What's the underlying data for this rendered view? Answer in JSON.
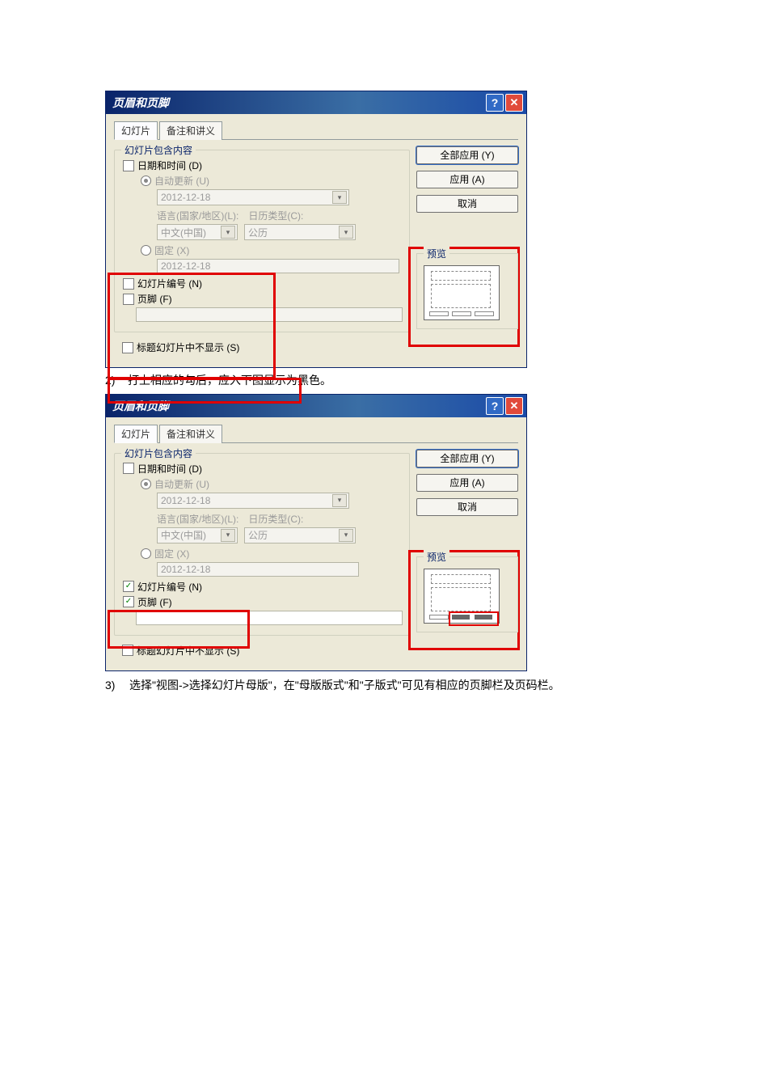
{
  "dialog": {
    "title": "页眉和页脚",
    "help": "?",
    "close": "✕",
    "tabs": {
      "slide": "幻灯片",
      "notes": "备注和讲义"
    },
    "group_title": "幻灯片包含内容",
    "date_time": "日期和时间 (D)",
    "auto_update": "自动更新 (U)",
    "date_value": "2012-12-18",
    "lang_label": "语言(国家/地区)(L):",
    "cal_label": "日历类型(C):",
    "lang_value": "中文(中国)",
    "cal_value": "公历",
    "fixed": "固定 (X)",
    "fixed_value": "2012-12-18",
    "slide_number": "幻灯片编号 (N)",
    "footer": "页脚 (F)",
    "not_on_title": "标题幻灯片中不显示 (S)",
    "apply_all": "全部应用 (Y)",
    "apply": "应用 (A)",
    "cancel": "取消",
    "preview": "预览"
  },
  "steps": {
    "s2": "打上相应的勾后，应入下图显示为黑色。",
    "s3": "选择\"视图->选择幻灯片母版\"，在\"母版版式\"和\"子版式\"可见有相应的页脚栏及页码栏。"
  }
}
